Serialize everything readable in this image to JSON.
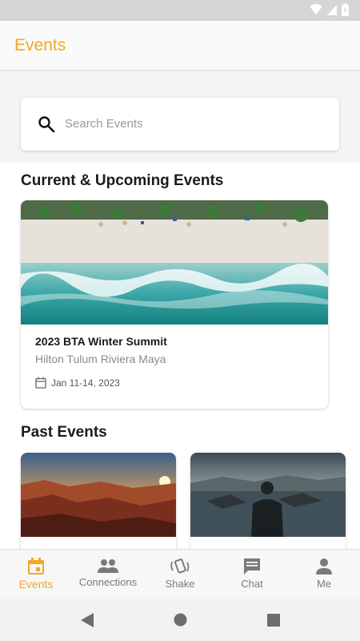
{
  "app": {
    "title": "Events"
  },
  "search": {
    "placeholder": "Search Events"
  },
  "sections": {
    "current": "Current & Upcoming Events",
    "past": "Past Events"
  },
  "current_event": {
    "title": "2023 BTA Winter Summit",
    "location": "Hilton Tulum Riviera Maya",
    "date": "Jan 11-14, 2023"
  },
  "nav": {
    "items": [
      {
        "label": "Events",
        "icon": "calendar-icon",
        "active": true
      },
      {
        "label": "Connections",
        "icon": "people-icon",
        "active": false
      },
      {
        "label": "Shake",
        "icon": "shake-phone-icon",
        "active": false
      },
      {
        "label": "Chat",
        "icon": "chat-icon",
        "active": false
      },
      {
        "label": "Me",
        "icon": "person-icon",
        "active": false
      }
    ]
  },
  "colors": {
    "accent": "#f5a623",
    "inactive": "#7a7a7a"
  }
}
